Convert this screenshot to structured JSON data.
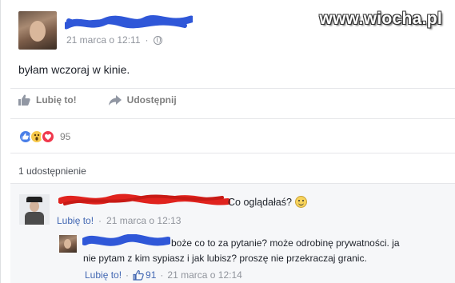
{
  "watermark": "www.wiocha.pl",
  "post": {
    "timestamp": "21 marca o 12:11",
    "text": "byłam wczoraj w kinie.",
    "actions": {
      "like_label": "Lubię to!",
      "share_label": "Udostępnij"
    },
    "reactions": {
      "types": [
        "like-icon",
        "wow-icon",
        "love-icon"
      ],
      "count": "95"
    },
    "shares_label": "1 udostępnienie"
  },
  "comments": [
    {
      "text": "Co oglądałaś?",
      "emoji": "smile-emoji",
      "like_label": "Lubię to!",
      "separator": "·",
      "timestamp": "21 marca o 12:13"
    },
    {
      "text_line1": "boże co to za pytanie? może odrobinę prywatności. ja",
      "text_line2": "nie pytam z kim sypiasz i jak lubisz? proszę nie przekraczaj granic.",
      "like_label": "Lubię to!",
      "separator": "·",
      "like_count": "91",
      "timestamp": "21 marca o 12:14"
    }
  ],
  "colors": {
    "link": "#4267b2",
    "meta": "#90949c",
    "scribble_blue": "#2f57d8",
    "scribble_red": "#e0231e",
    "like_reaction": "#4a7fe8",
    "love_reaction": "#f0394d",
    "wow_reaction": "#f7c84a"
  }
}
